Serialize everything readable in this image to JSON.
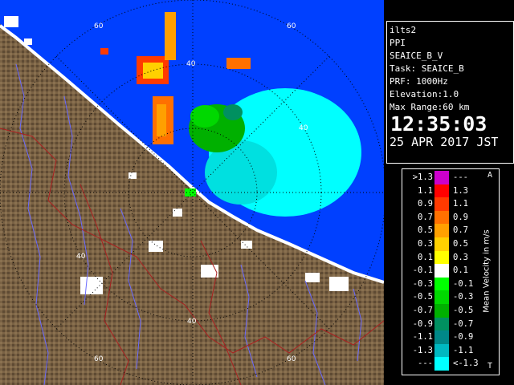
{
  "info": {
    "site": "ilts2",
    "scan_type": "PPI",
    "product": "SEAICE_B_V",
    "task": "Task: SEAICE_B",
    "prf": "PRF: 1000Hz",
    "elevation": "Elevation:1.0",
    "max_range": "Max Range:60 km",
    "time": "12:35:03",
    "date": "25 APR 2017 JST"
  },
  "legend": {
    "title": "Mean Velocity in m/s",
    "corner_top": "A",
    "corner_bottom": "T",
    "rows": [
      {
        "lo": ">1.3",
        "hi": "---",
        "color": "#cc00cc"
      },
      {
        "lo": "1.1",
        "hi": "1.3",
        "color": "#ff0000"
      },
      {
        "lo": "0.9",
        "hi": "1.1",
        "color": "#ff3a00"
      },
      {
        "lo": "0.7",
        "hi": "0.9",
        "color": "#ff7000"
      },
      {
        "lo": "0.5",
        "hi": "0.7",
        "color": "#ffa000"
      },
      {
        "lo": "0.3",
        "hi": "0.5",
        "color": "#ffd000"
      },
      {
        "lo": "0.1",
        "hi": "0.3",
        "color": "#ffff00"
      },
      {
        "lo": "-0.1",
        "hi": "0.1",
        "color": "#ffffff"
      },
      {
        "lo": "-0.3",
        "hi": "-0.1",
        "color": "#00ff00"
      },
      {
        "lo": "-0.5",
        "hi": "-0.3",
        "color": "#00d800"
      },
      {
        "lo": "-0.7",
        "hi": "-0.5",
        "color": "#00b000"
      },
      {
        "lo": "-0.9",
        "hi": "-0.7",
        "color": "#009060"
      },
      {
        "lo": "-1.1",
        "hi": "-0.9",
        "color": "#008888"
      },
      {
        "lo": "-1.3",
        "hi": "-1.1",
        "color": "#00b8c0"
      },
      {
        "lo": "---",
        "hi": "<-1.3",
        "color": "#00ffff"
      }
    ]
  },
  "range_labels": {
    "r40": "40",
    "r60": "60"
  },
  "colors": {
    "sea": "#0040ff",
    "land": "#7a6244",
    "echo_fast_toward": "#00ffff",
    "echo_green": "#00c000",
    "echo_orange": "#ff8000",
    "ring": "#000000",
    "river": "#6a6aff",
    "border": "#aa2020"
  }
}
